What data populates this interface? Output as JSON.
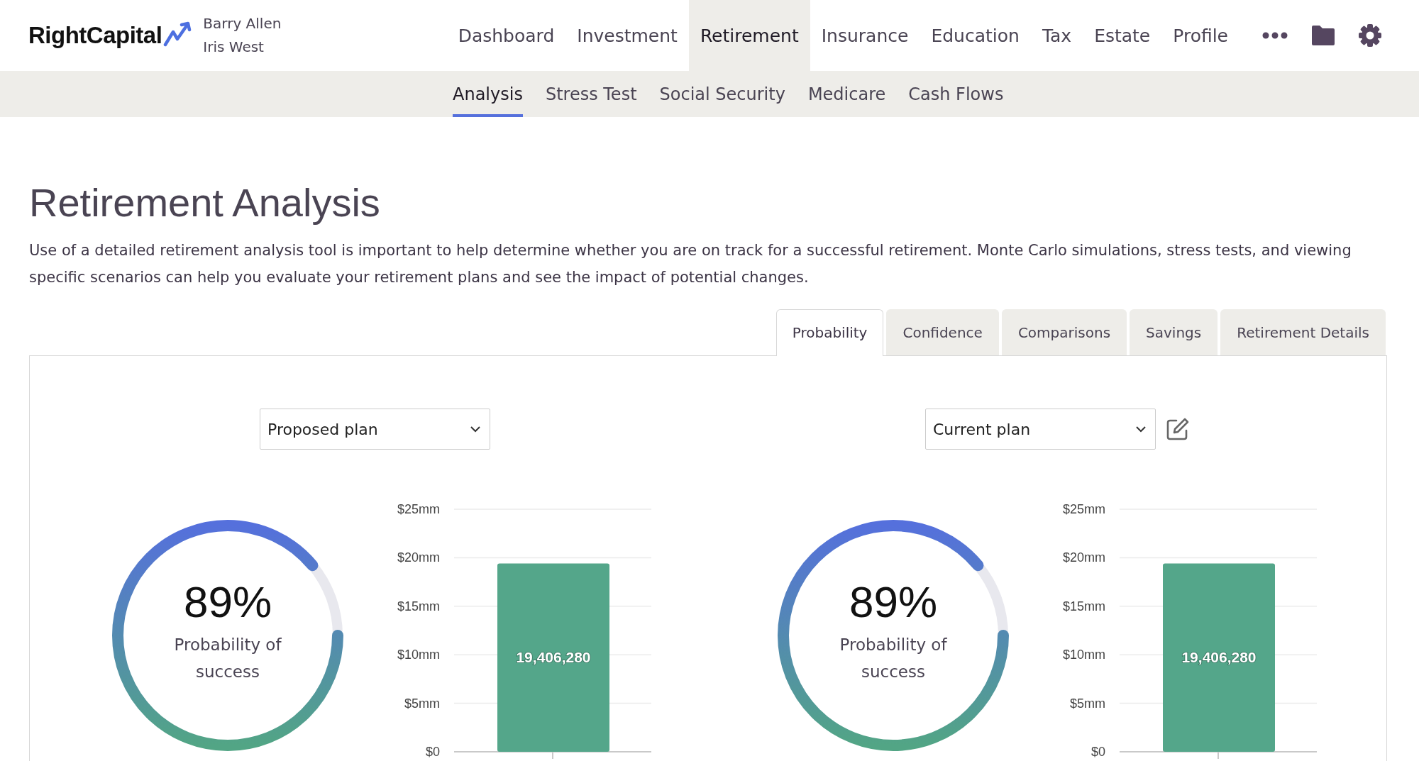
{
  "brand": {
    "name": "RightCapital"
  },
  "clients": [
    "Barry Allen",
    "Iris West"
  ],
  "nav": {
    "items": [
      {
        "label": "Dashboard",
        "selected": false
      },
      {
        "label": "Investment",
        "selected": false
      },
      {
        "label": "Retirement",
        "selected": true
      },
      {
        "label": "Insurance",
        "selected": false
      },
      {
        "label": "Education",
        "selected": false
      },
      {
        "label": "Tax",
        "selected": false
      },
      {
        "label": "Estate",
        "selected": false
      },
      {
        "label": "Profile",
        "selected": false
      }
    ]
  },
  "subnav": [
    {
      "label": "Analysis",
      "selected": true
    },
    {
      "label": "Stress Test",
      "selected": false
    },
    {
      "label": "Social Security",
      "selected": false
    },
    {
      "label": "Medicare",
      "selected": false
    },
    {
      "label": "Cash Flows",
      "selected": false
    }
  ],
  "page_title": "Retirement Analysis",
  "description": "Use of a detailed retirement analysis tool is important to help determine whether you are on track for a successful retirement. Monte Carlo simulations, stress tests, and viewing specific scenarios can help you evaluate your retirement plans and see the impact of potential changes.",
  "tabs": [
    {
      "label": "Probability",
      "selected": true
    },
    {
      "label": "Confidence",
      "selected": false
    },
    {
      "label": "Comparisons",
      "selected": false
    },
    {
      "label": "Savings",
      "selected": false
    },
    {
      "label": "Retirement Details",
      "selected": false
    }
  ],
  "plans": [
    {
      "select": {
        "value": "Proposed plan"
      },
      "editable": false,
      "probability": {
        "value": "89%",
        "label": "Probability of success",
        "level": 0.89
      },
      "chart_data": {
        "type": "bar",
        "values": [
          19.4
        ],
        "ylim": [
          0,
          25
        ],
        "yticks": [
          {
            "value": 0,
            "label": "$0"
          },
          {
            "value": 5,
            "label": "$5mm"
          },
          {
            "value": 10,
            "label": "$10mm"
          },
          {
            "value": 15,
            "label": "$15mm"
          },
          {
            "value": 20,
            "label": "$20mm"
          },
          {
            "value": 25,
            "label": "$25mm"
          }
        ],
        "grid": true,
        "annotations": [
          {
            "text": "19,406,280"
          }
        ],
        "color": "#54a68a"
      }
    },
    {
      "select": {
        "value": "Current plan"
      },
      "editable": true,
      "probability": {
        "value": "89%",
        "label": "Probability of success",
        "level": 0.89
      },
      "chart_data": {
        "type": "bar",
        "values": [
          19.4
        ],
        "ylim": [
          0,
          25
        ],
        "yticks": [
          {
            "value": 0,
            "label": "$0"
          },
          {
            "value": 5,
            "label": "$5mm"
          },
          {
            "value": 10,
            "label": "$10mm"
          },
          {
            "value": 15,
            "label": "$15mm"
          },
          {
            "value": 20,
            "label": "$20mm"
          },
          {
            "value": 25,
            "label": "$25mm"
          }
        ],
        "grid": true,
        "annotations": [
          {
            "text": "19,406,280"
          }
        ],
        "color": "#54a68a"
      }
    }
  ]
}
